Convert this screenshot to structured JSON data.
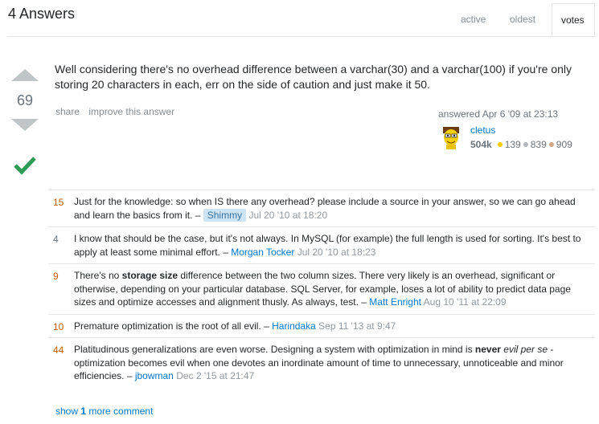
{
  "header": {
    "title": "4 Answers",
    "tabs": [
      {
        "label": "active"
      },
      {
        "label": "oldest"
      },
      {
        "label": "votes"
      }
    ]
  },
  "answer": {
    "score": "69",
    "accepted": true,
    "body": "Well considering there's no overhead difference between a varchar(30) and a varchar(100) if you're only storing 20 characters in each, err on the side of caution and just make it 50.",
    "menu": {
      "share": "share",
      "improve": "improve this answer"
    },
    "author": {
      "answered": "answered Apr 6 '09 at 23:13",
      "name": "cletus",
      "reputation": "504k",
      "gold": "139",
      "silver": "839",
      "bronze": "909"
    }
  },
  "comments": [
    {
      "score": "15",
      "text": "Just for the knowledge: so when IS there any overhead? please include a source in your answer, so we can go ahead and learn the basics from it.",
      "user": "Shimmy",
      "date": "Jul 20 '10 at 18:20"
    },
    {
      "score": "4",
      "text": "I know that should be the case, but it's not always. In MySQL (for example) the full length is used for sorting. It's best to apply at least some minimal effort.",
      "user": "Morgan Tocker",
      "date": "Jul 20 '10 at 18:23"
    },
    {
      "score": "9",
      "pre": "There's no ",
      "strong": "storage size",
      "post": " difference between the two column sizes. There very likely is an overhead, significant or otherwise, depending on your particular database. SQL Server, for example, loses a lot of ability to predict data page sizes and optimize accesses and alignment thusly. As always, test.",
      "user": "Matt Enright",
      "date": "Aug 10 '11 at 22:09"
    },
    {
      "score": "10",
      "text": "Premature optimization is the root of all evil.",
      "user": "Harindaka",
      "date": "Sep 11 '13 at 9:47"
    },
    {
      "score": "44",
      "pre": "Platitudinous generalizations are even worse. Designing a system with optimization in mind is ",
      "strong": "never",
      "space": " ",
      "em": "evil per se",
      "post": " - optimization becomes evil when one devotes an inordinate amount of time to unnecessary, unnoticeable and minor efficiencies.",
      "user": "jbowman",
      "date": "Dec 2 '15 at 21:47"
    }
  ],
  "show_more": {
    "prefix": "show ",
    "count": "1",
    "suffix": " more comment"
  },
  "colors": {
    "accepted": "#2f9c56",
    "gold": "#ffcc01",
    "silver": "#b4b8bc",
    "bronze": "#d1a684",
    "link": "#0077cc"
  }
}
